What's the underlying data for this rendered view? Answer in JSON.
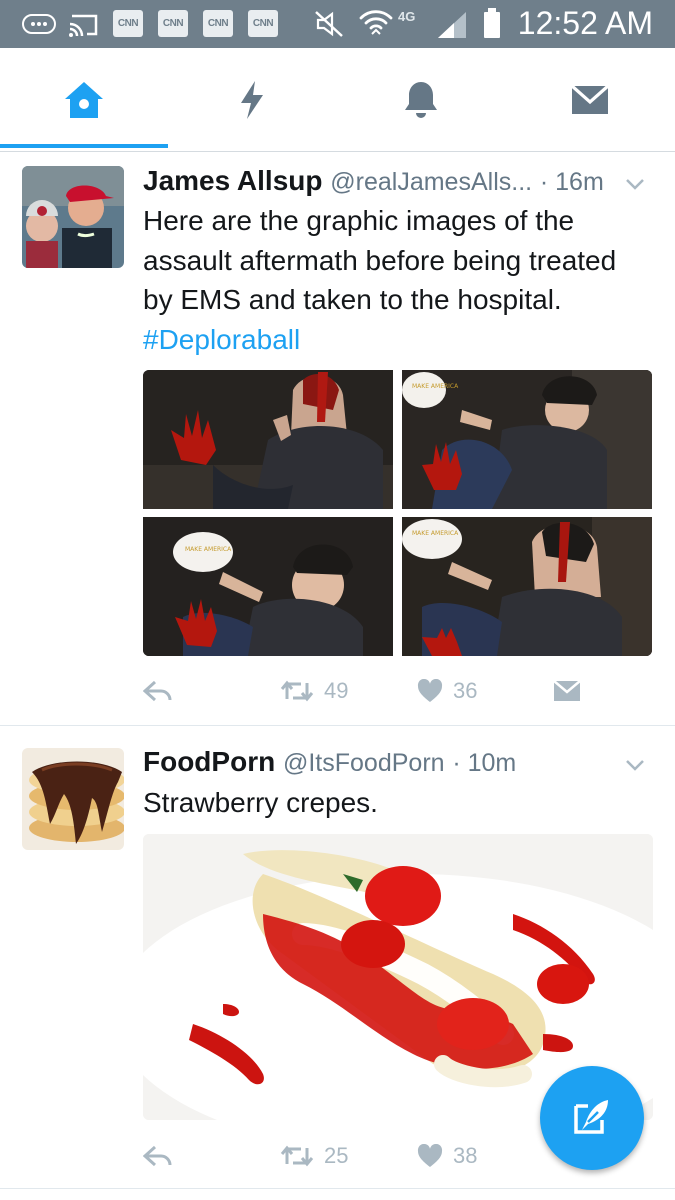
{
  "status_bar": {
    "time": "12:52 AM",
    "network": "4G",
    "notification_icons": [
      "CNN",
      "CNN",
      "CNN",
      "CNN"
    ]
  },
  "tabs": [
    {
      "name": "home",
      "icon": "home-icon",
      "active": true
    },
    {
      "name": "moments",
      "icon": "lightning-icon",
      "active": false
    },
    {
      "name": "notifications",
      "icon": "bell-icon",
      "active": false
    },
    {
      "name": "messages",
      "icon": "envelope-icon",
      "active": false
    }
  ],
  "colors": {
    "accent": "#1da1f2",
    "status_bar": "#6f7f8b",
    "secondary_text": "#657786",
    "action_icons": "#aab8c2"
  },
  "tweets": [
    {
      "name": "James Allsup",
      "handle": "@realJamesAlls...",
      "time": "· 16m",
      "text": "Here are the graphic images of the assault aftermath before being treated by EMS and taken to the hospital.",
      "hashtag": "#Deploraball",
      "retweets": "49",
      "likes": "36"
    },
    {
      "name": "FoodPorn",
      "handle": "@ItsFoodPorn",
      "time": "· 10m",
      "text": "Strawberry crepes.",
      "retweets": "25",
      "likes": "38"
    }
  ]
}
